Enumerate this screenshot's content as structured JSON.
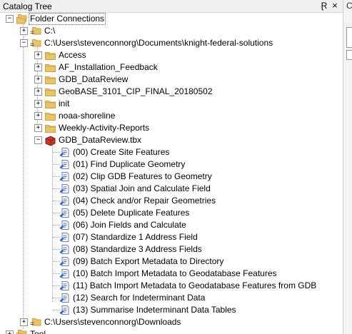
{
  "panel": {
    "title": "Catalog Tree",
    "pin_glyph": "Ɽ",
    "close_glyph": "×",
    "side_fragment": "C"
  },
  "tree": {
    "root": {
      "label": "Folder Connections",
      "expander": "−",
      "icon": "folder-connections-icon"
    },
    "c_drive": {
      "label": "C:\\",
      "expander": "+",
      "icon": "folder-connection-icon"
    },
    "project": {
      "label": "C:\\Users\\stevenconnorg\\Documents\\knight-federal-solutions",
      "expander": "−",
      "icon": "folder-connection-icon"
    },
    "folders": [
      {
        "label": "Access",
        "expander": "+"
      },
      {
        "label": "AF_Installation_Feedback",
        "expander": "+"
      },
      {
        "label": "GDB_DataReview",
        "expander": "+"
      },
      {
        "label": "GeoBASE_3101_CIP_FINAL_20180502",
        "expander": "+"
      },
      {
        "label": "init",
        "expander": "+"
      },
      {
        "label": "noaa-shoreline",
        "expander": "+"
      },
      {
        "label": "Weekly-Activity-Reports",
        "expander": "+"
      }
    ],
    "toolbox": {
      "label": "GDB_DataReview.tbx",
      "expander": "−",
      "icon": "toolbox-icon"
    },
    "tools": [
      "(00) Create Site Features",
      "(01) Find Duplicate Geometry",
      "(02) Clip GDB Features to Geometry",
      "(03) Spatial Join and Calculate Field",
      "(04) Check and/or Repair Geometries",
      "(05) Delete Duplicate Features",
      "(06) Join Fields and Calculate",
      "(07) Standardize 1 Address Field",
      "(08) Standardize 3 Address Fields",
      "(09) Batch Export Metadata to Directory",
      "(10) Batch Import Metadata to Geodatabase Features",
      "(11) Batch Import Metadata to Geodatabase Features from GDB",
      "(12) Search for Indeterminant Data",
      "(13) Summarise Indeterminant Data Tables"
    ],
    "downloads": {
      "label": "C:\\Users\\stevenconnorg\\Downloads",
      "expander": "+",
      "icon": "folder-connection-icon"
    },
    "partial": {
      "label": "Tool",
      "expander": "+"
    }
  },
  "colors": {
    "folder": "#e8c46a",
    "folder_dark": "#c9a23e",
    "toolbox": "#c0392b",
    "script": "#3a6bc4"
  }
}
